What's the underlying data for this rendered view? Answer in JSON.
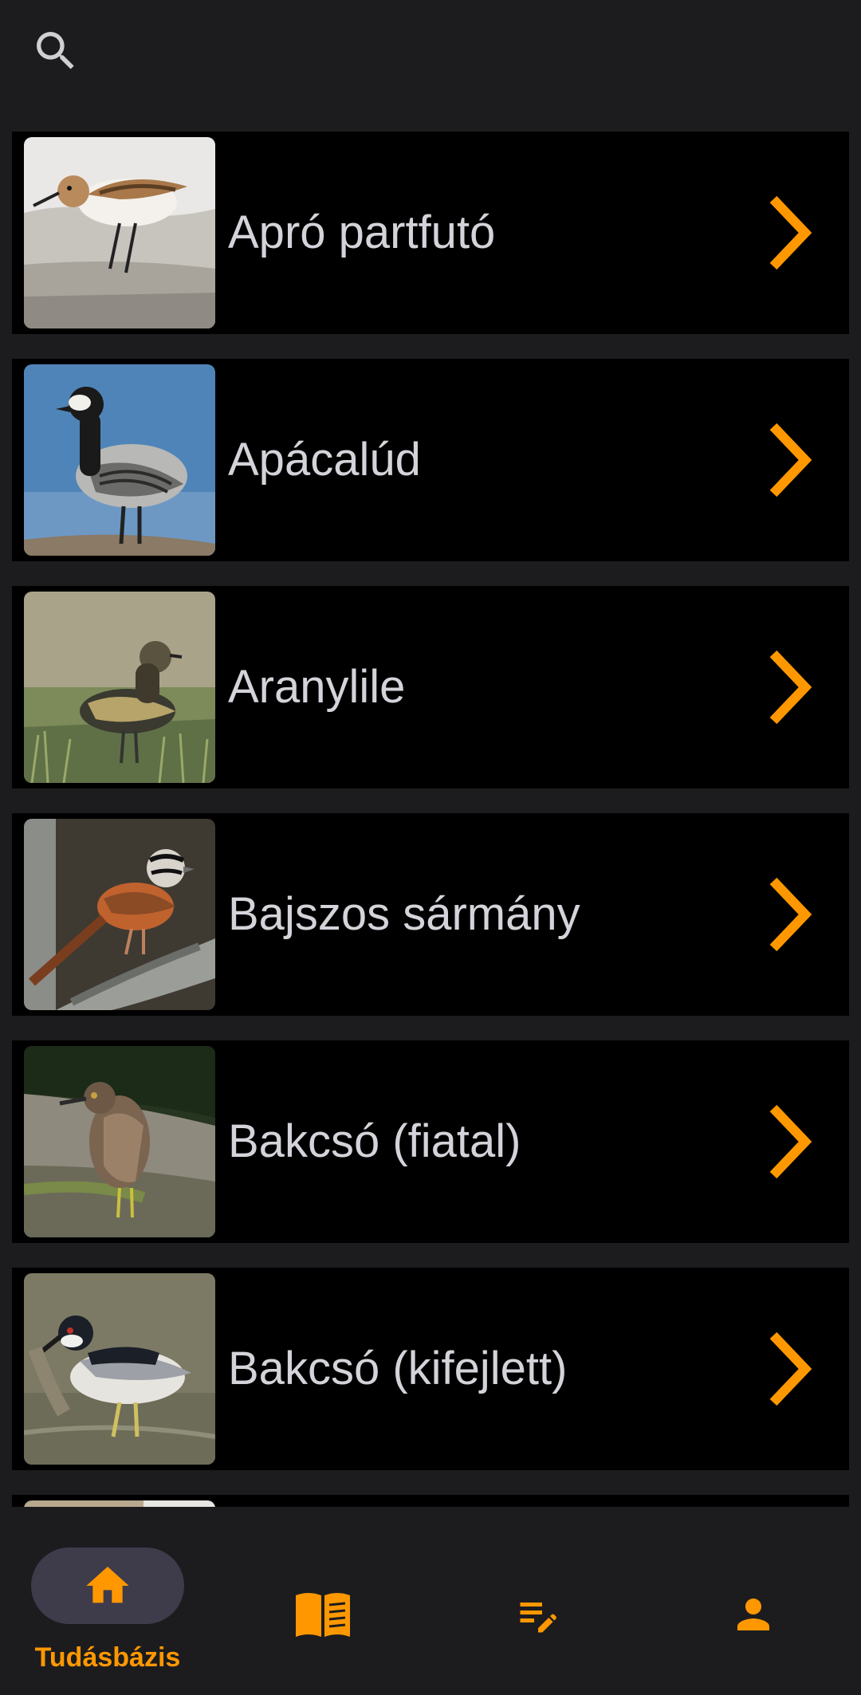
{
  "colors": {
    "accent": "#ff9800",
    "background": "#1c1c1f",
    "item_background": "#000000",
    "label_text": "#d5d3da",
    "active_nav_pill": "#3e3b4b",
    "search_icon": "#d0d0d0"
  },
  "top_bar": {
    "search_icon": "search-icon"
  },
  "birds": [
    {
      "name": "Apró partfutó",
      "thumbnail": "bird-photo",
      "chevron_icon": "chevron-right-icon"
    },
    {
      "name": "Apácalúd",
      "thumbnail": "bird-photo",
      "chevron_icon": "chevron-right-icon"
    },
    {
      "name": "Aranylile",
      "thumbnail": "bird-photo",
      "chevron_icon": "chevron-right-icon"
    },
    {
      "name": "Bajszos sármány",
      "thumbnail": "bird-photo",
      "chevron_icon": "chevron-right-icon"
    },
    {
      "name": "Bakcsó (fiatal)",
      "thumbnail": "bird-photo",
      "chevron_icon": "chevron-right-icon"
    },
    {
      "name": "Bakcsó (kifejlett)",
      "thumbnail": "bird-photo",
      "chevron_icon": "chevron-right-icon"
    },
    {
      "name": "",
      "thumbnail": "bird-photo",
      "chevron_icon": "chevron-right-icon"
    }
  ],
  "bottom_nav": {
    "items": [
      {
        "id": "knowledge-base",
        "label": "Tudásbázis",
        "icon": "home-icon",
        "active": true
      },
      {
        "id": "guide",
        "label": "",
        "icon": "book-icon",
        "active": false
      },
      {
        "id": "notes",
        "label": "",
        "icon": "edit-list-icon",
        "active": false
      },
      {
        "id": "profile",
        "label": "",
        "icon": "person-icon",
        "active": false
      }
    ]
  }
}
